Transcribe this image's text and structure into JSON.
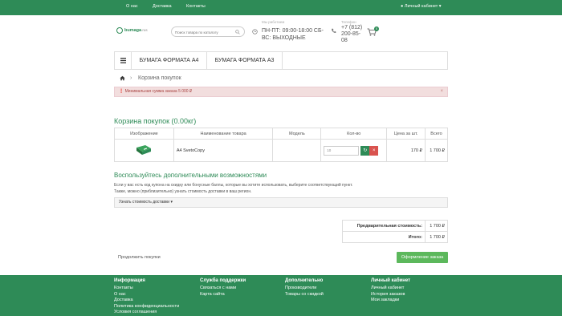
{
  "topbar": {
    "nav": [
      "О нас",
      "Доставка",
      "Контакты"
    ],
    "cabinet": "Личный кабинет"
  },
  "header": {
    "logo_text": "bumaga",
    "logo_suffix": ".rus",
    "search_placeholder": "Поиск товара по каталогу",
    "hours_label": "Мы работаем",
    "hours": "ПН-ПТ: 09:00-18:00 СБ-ВС: ВЫХОДНЫЕ",
    "phone_label": "Телефон",
    "phone": "+7 (812) 200-85-08",
    "cart_count": "0"
  },
  "menu": {
    "items": [
      "БУМАГА ФОРМАТА А4",
      "БУМАГА ФОРМАТА А3"
    ]
  },
  "breadcrumb": {
    "current": "Корзина покупок"
  },
  "alert": {
    "text": "Минимальная сумма заказа 5 000 ₽"
  },
  "cart": {
    "title": "Корзина покупок  (0.00кг)",
    "columns": [
      "Изображение",
      "Наименование товара",
      "Модель",
      "Кол-во",
      "Цена за шт.",
      "Всего"
    ],
    "rows": [
      {
        "name": "A4 SvetoCopy",
        "model": "",
        "qty": "10",
        "price": "170 ₽",
        "total": "1 700 ₽"
      }
    ]
  },
  "extras": {
    "title": "Воспользуйтесь дополнительными возможностями",
    "line1": "Если у вас есть код купона на скидку или бонусные баллы, которые вы хотите использовать, выберите соответствующий пункт.",
    "line2": "Также, можно (приблизительно) узнать стоимость доставки в ваш регион.",
    "shipping": "Узнать стоимость доставки"
  },
  "totals": [
    {
      "label": "Предварительная стоимость:",
      "value": "1 700 ₽"
    },
    {
      "label": "Итого:",
      "value": "1 700 ₽"
    }
  ],
  "actions": {
    "continue": "Продолжить покупки",
    "checkout": "Оформление заказа"
  },
  "footer": {
    "columns": [
      {
        "title": "Информация",
        "links": [
          "Контакты",
          "О нас",
          "Доставка",
          "Политика конфиденциальности",
          "Условия соглашения"
        ]
      },
      {
        "title": "Служба поддержки",
        "links": [
          "Связаться с нами",
          "Карта сайта"
        ]
      },
      {
        "title": "Дополнительно",
        "links": [
          "Производители",
          "Товары со скидкой"
        ]
      },
      {
        "title": "Личный кабинет",
        "links": [
          "Личный кабинет",
          "История заказов",
          "Мои закладки"
        ]
      }
    ]
  },
  "colors": {
    "brand": "#2e8b57",
    "checkout": "#5cb85c",
    "alert_bg": "#f2dede",
    "delete": "#d9534f"
  }
}
